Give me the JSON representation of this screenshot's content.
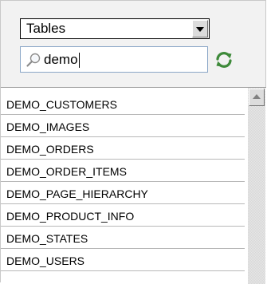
{
  "object_type_select": {
    "selected": "Tables",
    "icon": "chevron-down-icon"
  },
  "search": {
    "value": "demo",
    "icon": "search-icon"
  },
  "refresh": {
    "icon": "refresh-icon",
    "color": "#3e8a3a"
  },
  "list": {
    "items": [
      {
        "label": "DEMO_CUSTOMERS"
      },
      {
        "label": "DEMO_IMAGES"
      },
      {
        "label": "DEMO_ORDERS"
      },
      {
        "label": "DEMO_ORDER_ITEMS"
      },
      {
        "label": "DEMO_PAGE_HIERARCHY"
      },
      {
        "label": "DEMO_PRODUCT_INFO"
      },
      {
        "label": "DEMO_STATES"
      },
      {
        "label": "DEMO_USERS"
      }
    ]
  }
}
